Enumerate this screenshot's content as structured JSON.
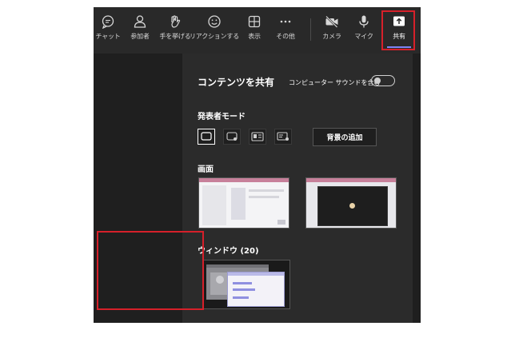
{
  "toolbar": {
    "items": [
      {
        "label": "チャット",
        "icon": "chat-icon"
      },
      {
        "label": "参加者",
        "icon": "participants-icon"
      },
      {
        "label": "手を挙げる",
        "icon": "raise-hand-icon"
      },
      {
        "label": "リアクションする",
        "icon": "reaction-icon"
      },
      {
        "label": "表示",
        "icon": "view-icon"
      },
      {
        "label": "その他",
        "icon": "more-icon"
      },
      {
        "label": "カメラ",
        "icon": "camera-off-icon"
      },
      {
        "label": "マイク",
        "icon": "mic-icon"
      },
      {
        "label": "共有",
        "icon": "share-icon"
      }
    ]
  },
  "panel": {
    "title": "コンテンツを共有",
    "system_sound_label": "コンピューター サウンドを含む",
    "presenter_mode_heading": "発表者モード",
    "background_button": "背景の追加",
    "screen_heading": "画面",
    "window_heading": "ウィンドウ (20)"
  },
  "colors": {
    "accent": "#7f85f5",
    "highlight": "#d6202a",
    "panel_bg": "#2b2b2b"
  }
}
